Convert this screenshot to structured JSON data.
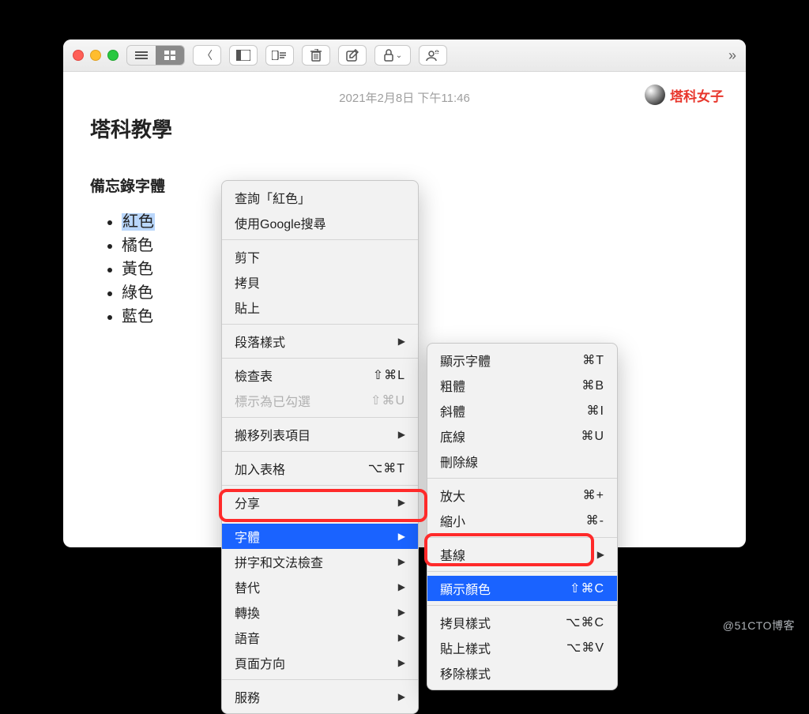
{
  "titlebar": {},
  "timestamp": "2021年2月8日 下午11:46",
  "brand": "塔科女子",
  "note": {
    "title": "塔科教學",
    "sub_visible": "備忘錄字體",
    "items": [
      "紅色",
      "橘色",
      "黃色",
      "綠色",
      "藍色"
    ]
  },
  "context_menu": {
    "lookup": "查詢「紅色」",
    "google": "使用Google搜尋",
    "cut": "剪下",
    "copy": "拷貝",
    "paste": "貼上",
    "paragraph_style": "段落樣式",
    "checklist": {
      "label": "檢查表",
      "shortcut": "⇧⌘L"
    },
    "mark_checked": {
      "label": "標示為已勾選",
      "shortcut": "⇧⌘U"
    },
    "move_list": "搬移列表項目",
    "add_table": {
      "label": "加入表格",
      "shortcut": "⌥⌘T"
    },
    "share": "分享",
    "font": "字體",
    "spellcheck": "拼字和文法檢查",
    "substitute": "替代",
    "transform": "轉換",
    "speech": "語音",
    "page_direction": "頁面方向",
    "services": "服務"
  },
  "submenu": {
    "show_fonts": {
      "label": "顯示字體",
      "shortcut": "⌘T"
    },
    "bold": {
      "label": "粗體",
      "shortcut": "⌘B"
    },
    "italic": {
      "label": "斜體",
      "shortcut": "⌘I"
    },
    "underline": {
      "label": "底線",
      "shortcut": "⌘U"
    },
    "strike": "刪除線",
    "bigger": {
      "label": "放大",
      "shortcut": "⌘+"
    },
    "smaller": {
      "label": "縮小",
      "shortcut": "⌘-"
    },
    "baseline": "基線",
    "show_colors": {
      "label": "顯示顏色",
      "shortcut": "⇧⌘C"
    },
    "copy_style": {
      "label": "拷貝樣式",
      "shortcut": "⌥⌘C"
    },
    "paste_style": {
      "label": "貼上樣式",
      "shortcut": "⌥⌘V"
    },
    "remove_style": "移除樣式"
  },
  "watermark": "@51CTO博客"
}
